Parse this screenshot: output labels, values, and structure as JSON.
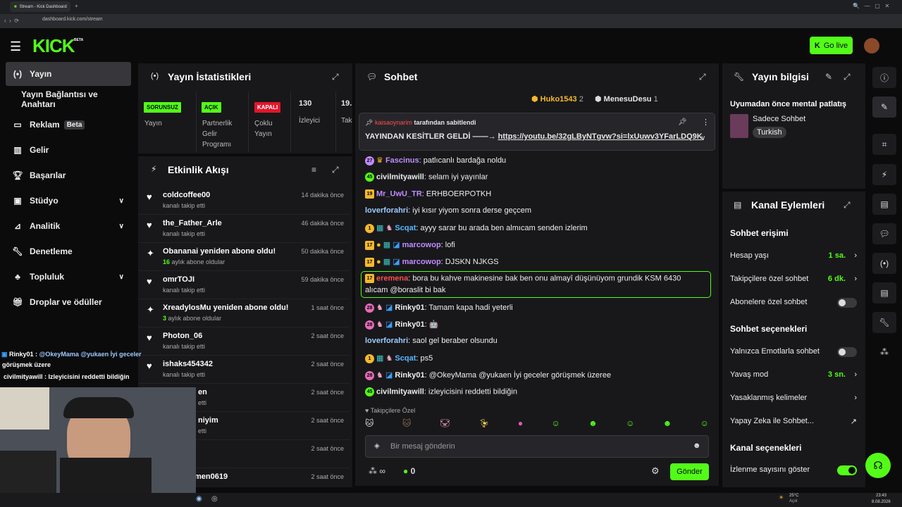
{
  "browser": {
    "tab_title": "Stream - Kick Dashboard",
    "url": "dashboard.kick.com/stream"
  },
  "header": {
    "logo": "KICK",
    "logo_badge": "BETA",
    "go_live": "Go live"
  },
  "sidebar": {
    "items": [
      {
        "label": "Yayın",
        "icon": "broadcast-icon"
      },
      {
        "label": "Yayın Bağlantısı ve Anahtarı"
      },
      {
        "label": "Reklam",
        "badge": "Beta",
        "icon": "tv-icon"
      },
      {
        "label": "Gelir",
        "icon": "chart-icon"
      },
      {
        "label": "Başarılar",
        "icon": "trophy-icon"
      },
      {
        "label": "Stüdyo",
        "icon": "studio-icon"
      },
      {
        "label": "Analitik",
        "icon": "analytics-icon"
      },
      {
        "label": "Denetleme",
        "icon": "wrench-icon"
      },
      {
        "label": "Topluluk",
        "icon": "community-icon"
      },
      {
        "label": "Droplar ve ödüller",
        "icon": "gift-icon"
      }
    ]
  },
  "stats": {
    "title": "Yayın İstatistikleri",
    "cols": [
      {
        "tag": "SORUNSUZ",
        "label": "Yayın"
      },
      {
        "tag": "AÇIK",
        "label": "Partnerlik Gelir Programı"
      },
      {
        "tag": "KAPALI",
        "label": "Çoklu Yayın"
      },
      {
        "tag": "130",
        "label": "İzleyici"
      },
      {
        "tag": "19.",
        "label": "Tak"
      }
    ]
  },
  "feed": {
    "title": "Etkinlik Akışı",
    "items": [
      {
        "name": "coldcoffee00",
        "sub": "kanalı takip etti",
        "time": "14 dakika önce"
      },
      {
        "name": "the_Father_Arle",
        "sub": "kanalı takip etti",
        "time": "46 dakika önce"
      },
      {
        "name": "Obananai yeniden abone oldu!",
        "num": "16",
        "sub": " aylık abone oldular",
        "time": "50 dakika önce"
      },
      {
        "name": "omrTOJI",
        "sub": "kanalı takip etti",
        "time": "59 dakika önce"
      },
      {
        "name": "XreadylosMu yeniden abone oldu!",
        "num": "3",
        "sub": " aylık abone oldular",
        "time": "1 saat önce"
      },
      {
        "name": "Photon_06",
        "sub": "kanalı takip etti",
        "time": "2 saat önce"
      },
      {
        "name": "ishaks454342",
        "sub": "kanalı takip etti",
        "time": "2 saat önce"
      },
      {
        "name": "en",
        "sub": "etti",
        "time": "2 saat önce"
      },
      {
        "name": "niyim",
        "sub": "etti",
        "time": "2 saat önce"
      },
      {
        "name": "",
        "sub": "",
        "time": "2 saat önce"
      },
      {
        "name": "men0619",
        "sub": "",
        "time": "2 saat önce"
      }
    ]
  },
  "overlay": {
    "line1_user": "Rinky01 :",
    "line1_text": " @OkeyMama @yukaen İyi geceler",
    "line2": "görüşmek üzere",
    "line3": "civilmityawill : Izleyicisini reddetti bildiğin"
  },
  "chat": {
    "title": "Sohbet",
    "top_gifters": [
      {
        "name": "Huko1543",
        "count": "2"
      },
      {
        "name": "MenesuDesu",
        "count": "1"
      }
    ],
    "pinned": {
      "by": "kaisaoynarim",
      "by_suffix": "tarafından sabitlendi",
      "text": "YAYINDAN KESİTLER GELDİ ——→ ",
      "link": "https://youtu.be/32gLByNTgvw?si=lxUuwv3YFarLDQ9K"
    },
    "messages": [
      {
        "badge": "27",
        "user": "Fascinus",
        "color": "#c18cff",
        "text": "patlıcanlı bardağa noldu"
      },
      {
        "badge": "45",
        "user": "civilmityawill",
        "color": "#ffffff",
        "text": "selam iyi yayınlar"
      },
      {
        "badge": "19",
        "user": "Mr_UwU_TR",
        "color": "#c18cff",
        "text": "ERHBOERPOTKH"
      },
      {
        "badge": "",
        "user": "loverforahri",
        "color": "#9ecbff",
        "text": "iyi kısır yiyom sonra derse geçcem"
      },
      {
        "badge": "1",
        "user": "Scqat",
        "color": "#59b8ff",
        "text": "ayyy sarar bu arada ben almıcam senden izlerim"
      },
      {
        "badge": "17",
        "user": "marcowop",
        "color": "#c18cff",
        "text": "lofi"
      },
      {
        "badge": "17",
        "user": "marcowop",
        "color": "#c18cff",
        "text": "DJSKN NJKGS"
      },
      {
        "badge": "17",
        "user": "eremena",
        "color": "#ff4d4d",
        "text": "bora bu kahve makinesine bak ben onu almayî düşünüyom grundik KSM 6430",
        "text2": "alıcam @boraslit bi bak"
      },
      {
        "badge": "28",
        "user": "Rinky01",
        "color": "#ffffff",
        "text": "Tamam kapa hadi yeterli"
      },
      {
        "badge": "28",
        "user": "Rinky01",
        "color": "#ffffff",
        "text": "🤖"
      },
      {
        "badge": "",
        "user": "loverforahri",
        "color": "#9ecbff",
        "text": "saol gel beraber olsundu"
      },
      {
        "badge": "1",
        "user": "Scqat",
        "color": "#59b8ff",
        "text": "ps5"
      },
      {
        "badge": "28",
        "user": "Rinky01",
        "color": "#ffffff",
        "text": "@OkeyMama @yukaen İyi geceler görüşmek üzeree"
      },
      {
        "badge": "45",
        "user": "civilmityawill",
        "color": "#ffffff",
        "text": "izleyicisini reddetti bildiğin"
      }
    ],
    "followers_only": "Takipçilere Özel",
    "input_placeholder": "Bir mesaj gönderin",
    "points": "0",
    "send": "Gönder"
  },
  "info": {
    "title": "Yayın bilgisi",
    "stream_title": "Uyumadan önce mental patlatış",
    "category": "Sadece Sohbet",
    "language": "Turkish"
  },
  "actions": {
    "title": "Kanal Eylemleri",
    "chat_access": "Sohbet erişimi",
    "account_age": "Hesap yaşı",
    "account_age_val": "1 sa.",
    "followers_chat": "Takipçilere özel sohbet",
    "followers_chat_val": "6 dk.",
    "subs_chat": "Abonelere özel sohbet",
    "chat_options": "Sohbet seçenekleri",
    "emote_only": "Yalnızca Emotlarla sohbet",
    "slow_mode": "Yavaş mod",
    "slow_mode_val": "3 sn.",
    "banned_words": "Yasaklanmış kelimeler",
    "ai_chat": "Yapay Zeka ile Sohbet...",
    "channel_options": "Kanal seçenekleri",
    "show_views": "İzlenme sayısını göster"
  },
  "taskbar": {
    "weather": "25°C",
    "weather_sub": "Açık",
    "time": "23:43",
    "date": "8.08.2026"
  }
}
